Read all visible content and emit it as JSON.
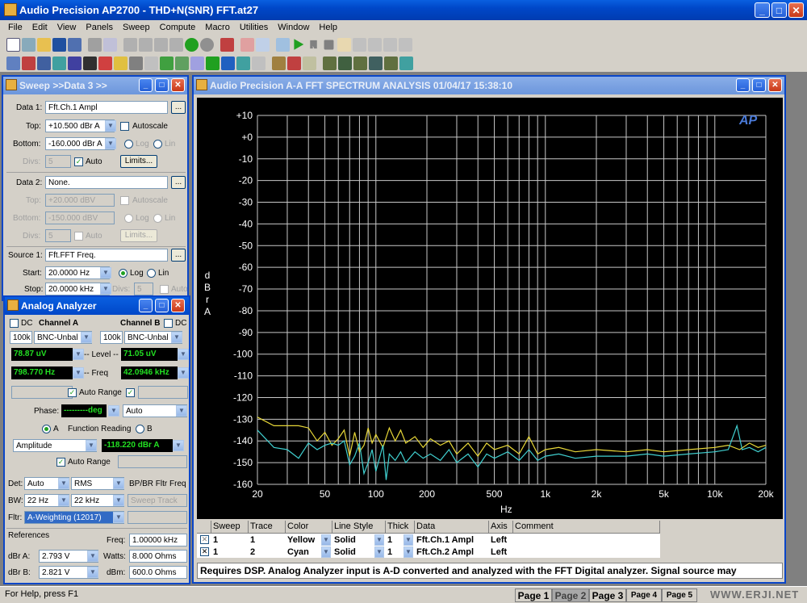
{
  "app": {
    "title": "Audio Precision AP2700 - THD+N(SNR) FFT.at27",
    "menu": [
      "File",
      "Edit",
      "View",
      "Panels",
      "Sweep",
      "Compute",
      "Macro",
      "Utilities",
      "Window",
      "Help"
    ],
    "status": "For Help, press F1",
    "pages": [
      "Page 1",
      "Page 2",
      "Page 3",
      "Page 4",
      "Page 5"
    ],
    "active_page": "Page 2",
    "watermark": "WWW.ERJI.NET"
  },
  "sweep_panel": {
    "title": "Sweep  >>Data 3  >>",
    "data1_label": "Data 1:",
    "data1_value": "Fft.Ch.1 Ampl",
    "top_label": "Top:",
    "top_value": "+10.500  dBr A",
    "autoscale": "Autoscale",
    "bottom_label": "Bottom:",
    "bottom_value": "-160.000 dBr A",
    "log": "Log",
    "lin": "Lin",
    "divs_label": "Divs:",
    "divs_value": "5",
    "auto": "Auto",
    "limits": "Limits...",
    "data2_label": "Data 2:",
    "data2_value": "None.",
    "top2_value": "+20.000  dBV",
    "bottom2_value": "-150.000 dBV",
    "divs2_value": "5",
    "source1_label": "Source 1:",
    "source1_value": "Fft.FFT Freq.",
    "start_label": "Start:",
    "start_value": "20.0000  Hz",
    "stop_label": "Stop:",
    "stop_value": "20.0000 kHz",
    "divs3_label": "Divs:",
    "divs3_value": "5",
    "browse": "..."
  },
  "analyzer_panel": {
    "title": "Analog Analyzer",
    "dc": "DC",
    "channel_a": "Channel A",
    "channel_b": "Channel B",
    "range_a": "100k",
    "input_a": "BNC-Unbal",
    "range_b": "100k",
    "input_b": "BNC-Unbal",
    "level_a": "78.87  uV",
    "level_label": "-- Level --",
    "level_b": "71.05  uV",
    "freq_a": "798.770  Hz",
    "freq_label": "-- Freq",
    "freq_b": "42.0946 kHz",
    "auto_range": "Auto Range",
    "phase_label": "Phase:",
    "phase_value": "---------deg",
    "phase_mode": "Auto",
    "a": "A",
    "function_reading": "Function Reading",
    "b": "B",
    "function": "Amplitude",
    "reading": "-118.220 dBr A",
    "auto_range2": "Auto Range",
    "det_label": "Det:",
    "det_value": "Auto",
    "det_mode": "RMS",
    "bp_label": "BP/BR Fltr Freq",
    "bw_label": "BW:",
    "bw_low": "22 Hz",
    "bw_high": "22 kHz",
    "sweep_track": "Sweep Track",
    "fltr_label": "Fltr:",
    "fltr_value": "A-Weighting  (12017)",
    "references": "References",
    "freq_ref_label": "Freq:",
    "freq_ref": "1.00000 kHz",
    "dbra_label": "dBr A:",
    "dbra": "2.793   V",
    "watts_label": "Watts:",
    "watts": "8.000    Ohms",
    "dbrb_label": "dBr B:",
    "dbrb": "2.821   V",
    "dbm_label": "dBm:",
    "dbm": "600.0    Ohms"
  },
  "graph_window": {
    "title": "Audio Precision    A-A FFT SPECTRUM ANALYSIS     01/04/17  15:38:10",
    "logo": "AP",
    "ylabel": [
      "d",
      "B",
      "r",
      "",
      "A"
    ],
    "xlabel": "Hz",
    "info": "Requires DSP.  Analog Analyzer input is A-D converted and analyzed with the FFT Digital analyzer.  Signal source may"
  },
  "chart_data": {
    "type": "line",
    "ylim": [
      -160,
      10
    ],
    "xlim": [
      20,
      20000
    ],
    "xscale": "log",
    "grid": true,
    "ylabel": "dBr A",
    "xlabel": "Hz",
    "yticks": [
      "+10",
      "+0",
      "-10",
      "-20",
      "-30",
      "-40",
      "-50",
      "-60",
      "-70",
      "-80",
      "-90",
      "-100",
      "-110",
      "-120",
      "-130",
      "-140",
      "-150",
      "-160"
    ],
    "xticks": [
      {
        "v": 20,
        "t": "20"
      },
      {
        "v": 50,
        "t": "50"
      },
      {
        "v": 100,
        "t": "100"
      },
      {
        "v": 200,
        "t": "200"
      },
      {
        "v": 500,
        "t": "500"
      },
      {
        "v": 1000,
        "t": "1k"
      },
      {
        "v": 2000,
        "t": "2k"
      },
      {
        "v": 5000,
        "t": "5k"
      },
      {
        "v": 10000,
        "t": "10k"
      },
      {
        "v": 20000,
        "t": "20k"
      }
    ],
    "series": [
      {
        "name": "Fft.Ch.1 Ampl",
        "color": "#e8d838",
        "points": [
          [
            20,
            -129
          ],
          [
            25,
            -133
          ],
          [
            30,
            -133
          ],
          [
            35,
            -133
          ],
          [
            40,
            -134
          ],
          [
            45,
            -140
          ],
          [
            50,
            -136
          ],
          [
            55,
            -142
          ],
          [
            60,
            -139
          ],
          [
            65,
            -135
          ],
          [
            70,
            -147
          ],
          [
            75,
            -136
          ],
          [
            80,
            -145
          ],
          [
            85,
            -142
          ],
          [
            90,
            -134
          ],
          [
            95,
            -141
          ],
          [
            100,
            -137
          ],
          [
            110,
            -143
          ],
          [
            120,
            -134
          ],
          [
            130,
            -140
          ],
          [
            140,
            -135
          ],
          [
            150,
            -141
          ],
          [
            170,
            -138
          ],
          [
            190,
            -143
          ],
          [
            210,
            -139
          ],
          [
            240,
            -142
          ],
          [
            270,
            -140
          ],
          [
            300,
            -146
          ],
          [
            350,
            -141
          ],
          [
            400,
            -147
          ],
          [
            450,
            -141
          ],
          [
            500,
            -144
          ],
          [
            600,
            -142
          ],
          [
            700,
            -146
          ],
          [
            800,
            -138
          ],
          [
            900,
            -146
          ],
          [
            1000,
            -144
          ],
          [
            1200,
            -143
          ],
          [
            1500,
            -145
          ],
          [
            2000,
            -144
          ],
          [
            3000,
            -145
          ],
          [
            4000,
            -144
          ],
          [
            5000,
            -145
          ],
          [
            7000,
            -144
          ],
          [
            10000,
            -143
          ],
          [
            12000,
            -142
          ],
          [
            14000,
            -144
          ],
          [
            16000,
            -141
          ],
          [
            18000,
            -143
          ],
          [
            20000,
            -142
          ]
        ]
      },
      {
        "name": "Fft.Ch.2 Ampl",
        "color": "#40d0d0",
        "points": [
          [
            20,
            -135
          ],
          [
            25,
            -143
          ],
          [
            30,
            -144
          ],
          [
            35,
            -148
          ],
          [
            40,
            -141
          ],
          [
            45,
            -144
          ],
          [
            50,
            -142
          ],
          [
            55,
            -141
          ],
          [
            60,
            -142
          ],
          [
            65,
            -140
          ],
          [
            70,
            -151
          ],
          [
            75,
            -147
          ],
          [
            80,
            -141
          ],
          [
            85,
            -155
          ],
          [
            90,
            -150
          ],
          [
            95,
            -144
          ],
          [
            100,
            -154
          ],
          [
            110,
            -142
          ],
          [
            115,
            -158
          ],
          [
            120,
            -146
          ],
          [
            130,
            -149
          ],
          [
            140,
            -145
          ],
          [
            150,
            -150
          ],
          [
            170,
            -145
          ],
          [
            190,
            -148
          ],
          [
            210,
            -146
          ],
          [
            240,
            -149
          ],
          [
            270,
            -144
          ],
          [
            300,
            -150
          ],
          [
            350,
            -146
          ],
          [
            400,
            -152
          ],
          [
            450,
            -146
          ],
          [
            500,
            -148
          ],
          [
            600,
            -145
          ],
          [
            700,
            -149
          ],
          [
            800,
            -144
          ],
          [
            900,
            -149
          ],
          [
            1000,
            -147
          ],
          [
            1200,
            -146
          ],
          [
            1500,
            -148
          ],
          [
            2000,
            -147
          ],
          [
            3000,
            -147
          ],
          [
            4000,
            -146
          ],
          [
            5000,
            -147
          ],
          [
            7000,
            -146
          ],
          [
            10000,
            -145
          ],
          [
            12000,
            -144
          ],
          [
            13500,
            -133
          ],
          [
            14500,
            -144
          ],
          [
            16000,
            -143
          ],
          [
            18000,
            -145
          ],
          [
            20000,
            -143
          ]
        ]
      }
    ]
  },
  "trace_table": {
    "headers": [
      "Sweep",
      "Trace",
      "Color",
      "Line Style",
      "Thick",
      "Data",
      "Axis",
      "Comment"
    ],
    "rows": [
      [
        "1",
        "1",
        "Yellow",
        "Solid",
        "1",
        "Fft.Ch.1 Ampl",
        "Left",
        ""
      ],
      [
        "1",
        "2",
        "Cyan",
        "Solid",
        "1",
        "Fft.Ch.2 Ampl",
        "Left",
        ""
      ]
    ]
  }
}
